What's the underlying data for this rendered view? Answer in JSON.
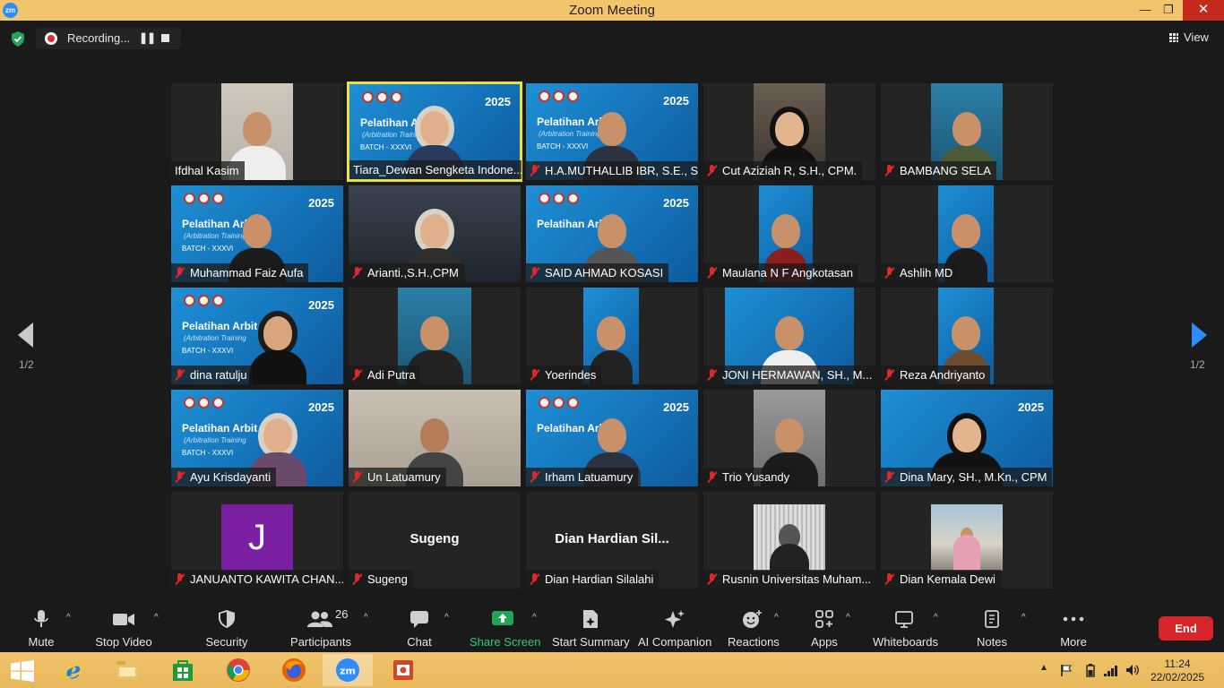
{
  "window": {
    "title": "Zoom Meeting",
    "app_icon_text": "zm",
    "minimize": "—",
    "maximize": "❐",
    "close": "✕"
  },
  "topbar": {
    "recording_label": "Recording...",
    "pause_glyph": "❚❚",
    "view_label": "View"
  },
  "gallery": {
    "page_indicator_left": "1/2",
    "page_indicator_right": "1/2",
    "banner": {
      "title": "Pelatihan Arbit",
      "subtitle": "(Arbitration Training",
      "batch": "BATCH - XXXVI",
      "year": "2025"
    },
    "tiles": [
      {
        "name": "Ifdhal Kasim",
        "muted": false
      },
      {
        "name": "Tiara_Dewan Sengketa Indone...",
        "muted": false,
        "active_speaker": true
      },
      {
        "name": "H.A.MUTHALLIB IBR, S.E., S....",
        "muted": true
      },
      {
        "name": "Cut Aziziah R, S.H., CPM.",
        "muted": true
      },
      {
        "name": "BAMBANG SELA",
        "muted": true
      },
      {
        "name": "Muhammad Faiz Aufa",
        "muted": true
      },
      {
        "name": "Arianti.,S.H.,CPM",
        "muted": true
      },
      {
        "name": "SAID AHMAD KOSASI",
        "muted": true
      },
      {
        "name": "Maulana N F Angkotasan",
        "muted": true
      },
      {
        "name": "Ashlih MD",
        "muted": true
      },
      {
        "name": "dina ratulju",
        "muted": true
      },
      {
        "name": "Adi Putra",
        "muted": true
      },
      {
        "name": "Yoerindes",
        "muted": true
      },
      {
        "name": "JONI HERMAWAN, SH., M...",
        "muted": true
      },
      {
        "name": "Reza Andriyanto",
        "muted": true
      },
      {
        "name": "Ayu Krisdayanti",
        "muted": true
      },
      {
        "name": "Un Latuamury",
        "muted": true
      },
      {
        "name": "Irham Latuamury",
        "muted": true
      },
      {
        "name": "Trio Yusandy",
        "muted": true
      },
      {
        "name": "Dina Mary, SH., M.Kn., CPM",
        "muted": true
      },
      {
        "name": "JANUANTO KAWITA CHAN...",
        "muted": true,
        "avatar_letter": "J"
      },
      {
        "name": "Sugeng",
        "muted": true,
        "display_name": "Sugeng"
      },
      {
        "name": "Dian Hardian Silalahi",
        "muted": true,
        "display_name": "Dian  Hardian  Sil..."
      },
      {
        "name": "Rusnin Universitas Muham...",
        "muted": true
      },
      {
        "name": "Dian Kemala Dewi",
        "muted": true
      }
    ]
  },
  "toolbar": {
    "mute": "Mute",
    "stop_video": "Stop Video",
    "security": "Security",
    "participants": "Participants",
    "participants_count": "26",
    "chat": "Chat",
    "share_screen": "Share Screen",
    "start_summary": "Start Summary",
    "ai_companion": "AI Companion",
    "reactions": "Reactions",
    "apps": "Apps",
    "whiteboards": "Whiteboards",
    "notes": "Notes",
    "more": "More",
    "end": "End",
    "caret": "^"
  },
  "taskbar": {
    "time": "11:24",
    "date": "22/02/2025",
    "zoom_label": "zm"
  },
  "colors": {
    "accent": "#2d8cff",
    "end": "#d7262b",
    "active_speaker": "#e9e23e",
    "share_green": "#2ecc71",
    "muted_red": "#e02828"
  }
}
